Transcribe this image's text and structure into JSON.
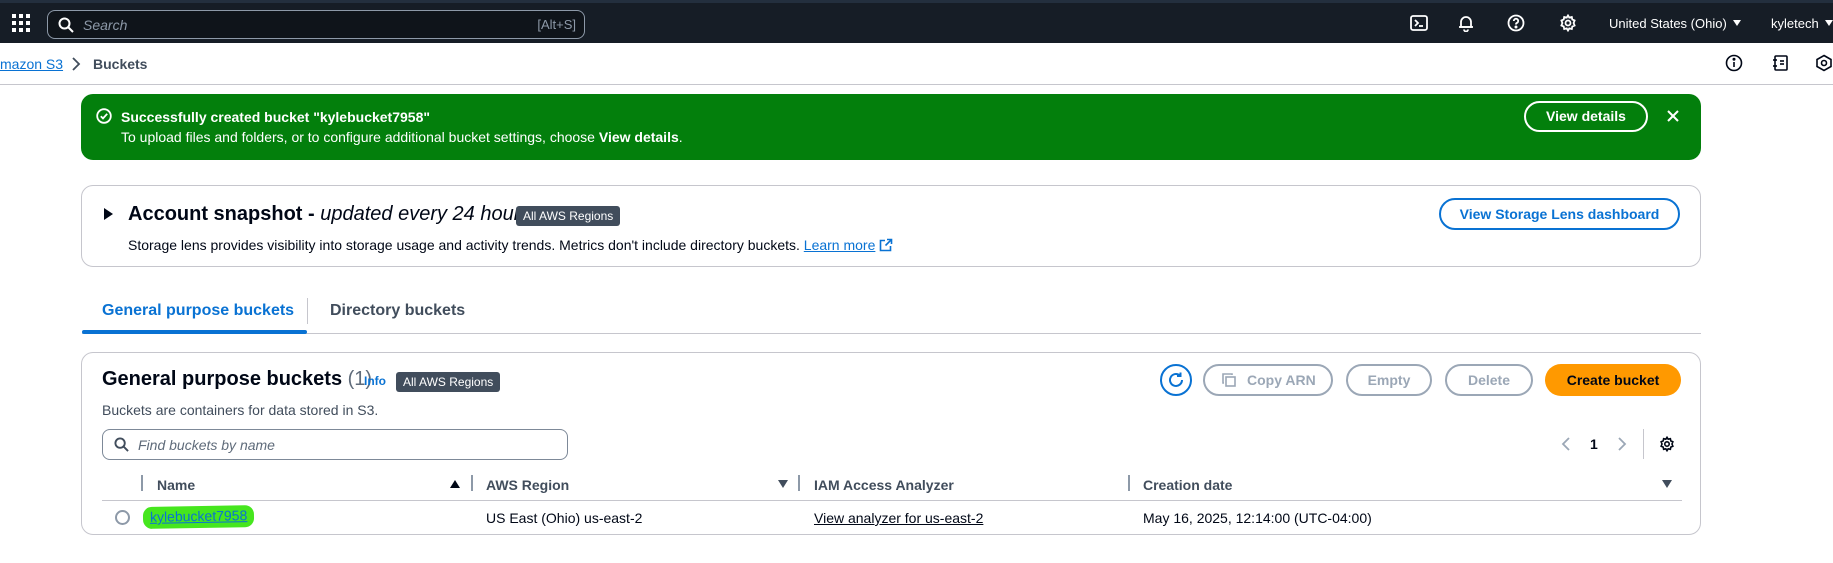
{
  "topbar": {
    "search_placeholder": "Search",
    "search_shortcut": "[Alt+S]",
    "region": "United States (Ohio)",
    "user": "kyletech"
  },
  "breadcrumb": {
    "items": [
      "mazon S3",
      "Buckets"
    ]
  },
  "flash": {
    "title": "Successfully created bucket \"kylebucket7958\"",
    "message_prefix": "To upload files and folders, or to configure additional bucket settings, choose ",
    "message_bold": "View details",
    "message_suffix": ".",
    "button": "View details",
    "color": "#037f0c"
  },
  "snapshot": {
    "title": "Account snapshot - ",
    "title_italic": "updated every 24 hours",
    "badge": "All AWS Regions",
    "description": "Storage lens provides visibility into storage usage and activity trends. Metrics don't include directory buckets. ",
    "learn_more": "Learn more",
    "button": "View Storage Lens dashboard"
  },
  "tabs": [
    {
      "label": "General purpose buckets",
      "active": true
    },
    {
      "label": "Directory buckets",
      "active": false
    }
  ],
  "buckets_panel": {
    "title": "General purpose buckets",
    "count": "(1)",
    "info": "Info",
    "badge": "All AWS Regions",
    "description": "Buckets are containers for data stored in S3.",
    "actions": {
      "copy_arn": "Copy ARN",
      "empty": "Empty",
      "delete": "Delete",
      "create": "Create bucket"
    },
    "search_placeholder": "Find buckets by name",
    "page": "1",
    "columns": [
      "Name",
      "AWS Region",
      "IAM Access Analyzer",
      "Creation date"
    ],
    "rows": [
      {
        "name": "kylebucket7958",
        "region": "US East (Ohio) us-east-2",
        "analyzer": "View analyzer for us-east-2",
        "created": "May 16, 2025, 12:14:00 (UTC-04:00)"
      }
    ]
  },
  "colors": {
    "topbar": "#161d26",
    "link": "#0972d3",
    "primary_button": "#ff9900",
    "highlight": "#46e61e"
  }
}
